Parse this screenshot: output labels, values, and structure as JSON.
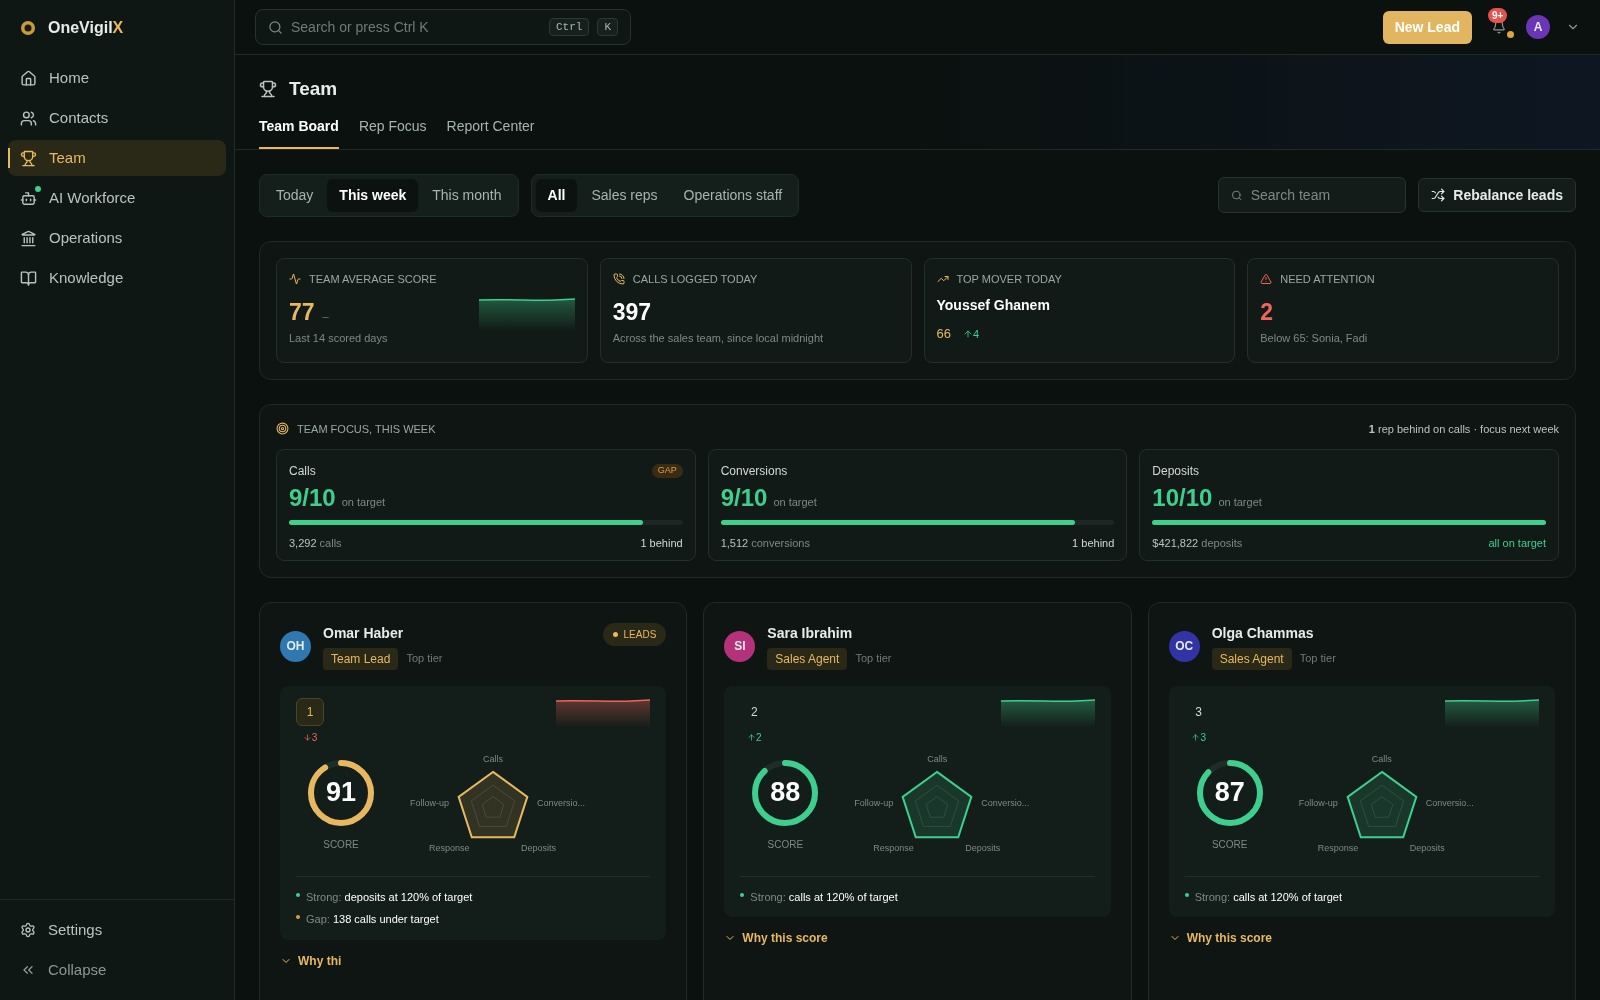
{
  "brand": {
    "name": "OneVigil",
    "accent": "X"
  },
  "sidebar": {
    "items": [
      {
        "label": "Home",
        "selected": false,
        "status_dot": false
      },
      {
        "label": "Contacts",
        "selected": false,
        "status_dot": false
      },
      {
        "label": "Team",
        "selected": true,
        "status_dot": false
      },
      {
        "label": "AI Workforce",
        "selected": false,
        "status_dot": true
      },
      {
        "label": "Operations",
        "selected": false,
        "status_dot": false
      },
      {
        "label": "Knowledge",
        "selected": false,
        "status_dot": false
      }
    ],
    "footer": [
      {
        "label": "Settings",
        "kind": "settings"
      },
      {
        "label": "Collapse",
        "kind": "collapse"
      }
    ]
  },
  "topbar": {
    "search": {
      "placeholder": "Search or press Ctrl K"
    },
    "keys": [
      "Ctrl",
      "K"
    ],
    "new_lead": "New Lead",
    "notifications": "9+",
    "avatar": "A"
  },
  "page": {
    "title": "Team",
    "tabs": [
      {
        "label": "Team Board",
        "selected": true
      },
      {
        "label": "Rep Focus",
        "selected": false
      },
      {
        "label": "Report Center",
        "selected": false
      }
    ]
  },
  "filters": {
    "period": [
      {
        "label": "Today",
        "selected": false
      },
      {
        "label": "This week",
        "selected": true
      },
      {
        "label": "This month",
        "selected": false
      }
    ],
    "audience": [
      {
        "label": "All",
        "selected": true
      },
      {
        "label": "Sales reps",
        "selected": false
      },
      {
        "label": "Operations staff",
        "selected": false
      }
    ],
    "search": {
      "placeholder": "Search team"
    },
    "rebalance": "Rebalance leads"
  },
  "stats": [
    {
      "kind": "average",
      "label": "TEAM AVERAGE SCORE",
      "value": "77",
      "trend": "–",
      "note": "Last 14 scored days"
    },
    {
      "kind": "calls",
      "label": "CALLS LOGGED TODAY",
      "value": "397",
      "note": "Across the sales team, since local midnight"
    },
    {
      "kind": "mover",
      "label": "TOP MOVER TODAY",
      "value": "Youssef Ghanem",
      "score": "66",
      "delta": "4"
    },
    {
      "kind": "alert",
      "label": "NEED ATTENTION",
      "value": "2",
      "note": "Below 65: Sonia, Fadi"
    }
  ],
  "focus": {
    "title": "TEAM FOCUS, THIS WEEK",
    "summary": "**1** rep behind on calls · focus next week",
    "metrics": [
      {
        "label": "Calls",
        "value": "9/10",
        "suffix": "on target",
        "level": 0.9,
        "count": "3,292",
        "unit": "calls",
        "status": "1 behind",
        "on_target": false,
        "badge": "GAP"
      },
      {
        "label": "Conversions",
        "value": "9/10",
        "suffix": "on target",
        "level": 0.9,
        "count": "1,512",
        "unit": "conversions",
        "status": "1 behind",
        "on_target": false
      },
      {
        "label": "Deposits",
        "value": "10/10",
        "suffix": "on target",
        "level": 1,
        "count": "$421,822",
        "unit": "deposits",
        "status": "all on target",
        "on_target": true
      }
    ]
  },
  "reps": [
    {
      "initials": "OH",
      "color": "#2f78b0",
      "name": "Omar Haber",
      "role": "Team Lead",
      "tier": "Top tier",
      "badge": "LEADS",
      "rank": "1",
      "rank_boxed": true,
      "rank_change": {
        "down": true,
        "value": "3"
      },
      "score": "91",
      "score_label": "SCORE",
      "highlighted": true,
      "axes": [
        "Calls",
        "Conversio...",
        "Deposits",
        "Response",
        "Follow-up"
      ],
      "notes": [
        {
          "kind": "strong",
          "label": "Strong:",
          "text": "deposits at 120% of target"
        },
        {
          "kind": "gap",
          "label": "Gap:",
          "text": "138 calls under target"
        }
      ],
      "why": "Why thi"
    },
    {
      "initials": "SI",
      "color": "#b5327a",
      "name": "Sara Ibrahim",
      "role": "Sales Agent",
      "tier": "Top tier",
      "rank": "2",
      "rank_boxed": false,
      "rank_change": {
        "down": false,
        "value": "2"
      },
      "score": "88",
      "score_label": "SCORE",
      "highlighted": false,
      "axes": [
        "Calls",
        "Conversio...",
        "Deposits",
        "Response",
        "Follow-up"
      ],
      "notes": [
        {
          "kind": "strong",
          "label": "Strong:",
          "text": "calls at 120% of target"
        }
      ],
      "why": "Why this score"
    },
    {
      "initials": "OC",
      "color": "#3333a8",
      "name": "Olga Chammas",
      "role": "Sales Agent",
      "tier": "Top tier",
      "rank": "3",
      "rank_boxed": false,
      "rank_change": {
        "down": false,
        "value": "3"
      },
      "score": "87",
      "score_label": "SCORE",
      "highlighted": false,
      "axes": [
        "Calls",
        "Conversio...",
        "Deposits",
        "Response",
        "Follow-up"
      ],
      "notes": [
        {
          "kind": "strong",
          "label": "Strong:",
          "text": "calls at 120% of target"
        }
      ],
      "why": "Why this score"
    }
  ]
}
